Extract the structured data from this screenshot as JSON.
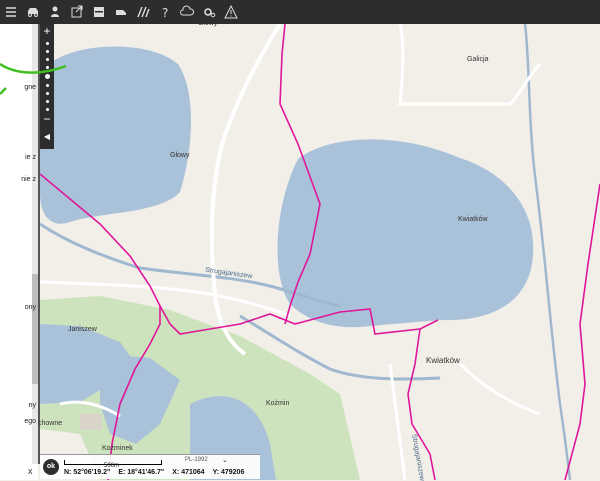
{
  "toolbar": {
    "icons": [
      "menu-icon",
      "car-icon",
      "person-icon",
      "export-icon",
      "layout-icon",
      "vehicle-icon",
      "hatch-icon",
      "help-icon",
      "cloud-icon",
      "settings-icon",
      "warning-icon"
    ]
  },
  "side_panel": {
    "lines": [
      "gne",
      "ie z",
      "nie z",
      "ony",
      "ny",
      "ego"
    ],
    "close_label": "x"
  },
  "map": {
    "labels": {
      "glowy_top": "Głowy",
      "glowy_lake": "Głowy",
      "galicja": "Galicja",
      "kwiatkow_lake": "Kwiatków",
      "kwiatkow_village": "Kwiatków",
      "strugajanisze": "Strugajaniszew",
      "janiszew": "Janiszew",
      "kozmin": "Koźmin",
      "kozminek": "Koźminek",
      "chowne": "chowne",
      "struga_vertical": "Strugajaniszew"
    },
    "colors": {
      "water": "#aac2d9",
      "meadow": "#cde3bd",
      "boundary": "#e0169a",
      "road": "#ffffff",
      "land": "#f2efe9"
    }
  },
  "zoom": {
    "in": "+",
    "out": "−",
    "collapse": "◀"
  },
  "status": {
    "ok": "ok",
    "scale": "500m",
    "projection": "PL-1992",
    "lat": "N: 52°06'19.2\"",
    "lon": "E: 18°41'46.7\"",
    "x": "X: 471064",
    "y": "Y: 479206"
  }
}
